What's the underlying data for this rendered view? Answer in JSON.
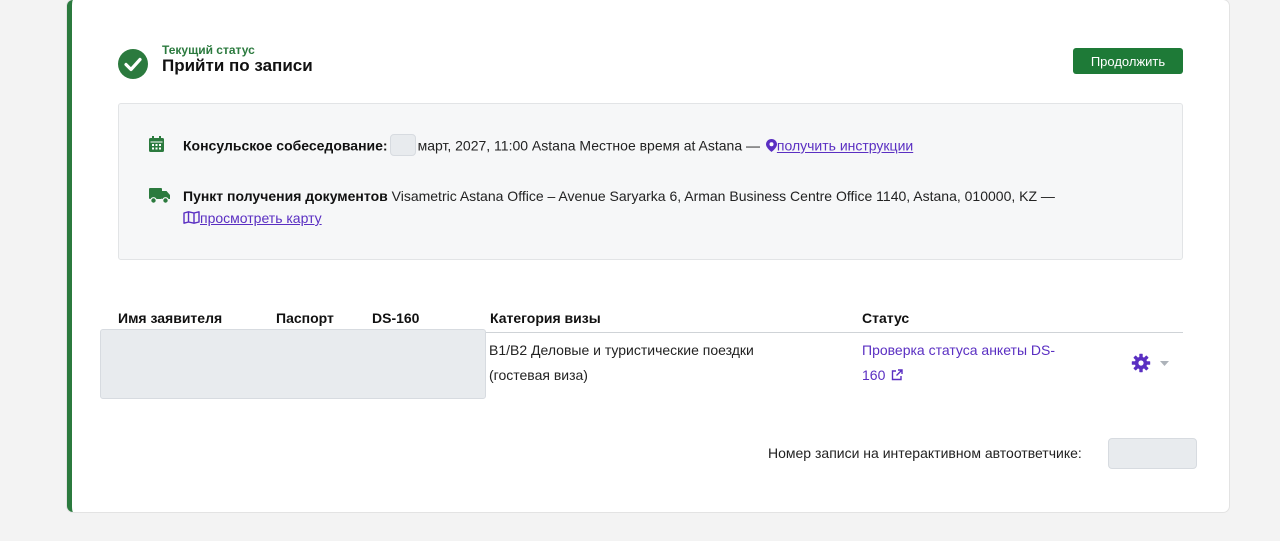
{
  "status": {
    "caption": "Текущий статус",
    "title": "Прийти по записи",
    "continue_label": "Продолжить"
  },
  "appointment": {
    "label": "Консульское собеседование:",
    "text": "март, 2027, 11:00 Astana Местное время at Astana —",
    "instructions_link": "получить инструкции",
    "pickup_label": "Пункт получения документов",
    "pickup_text": "Visametric Astana Office – Avenue Saryarka 6, Arman Business Centre Office 1140, Astana, 010000, KZ —",
    "map_link": "просмотреть карту"
  },
  "table": {
    "headers": {
      "name": "Имя заявителя",
      "passport": "Паспорт",
      "ds160": "DS-160",
      "category": "Категория визы",
      "status": "Статус"
    },
    "row": {
      "category_line1": "B1/B2 Деловые и туристические поездки",
      "category_line2": "(гостевая виза)",
      "status_line1": "Проверка статуса анкеты DS-",
      "status_line2": "160"
    }
  },
  "ivr": {
    "label": "Номер записи на интерактивном автоответчике:"
  },
  "colors": {
    "accent_green": "#2b7a3e",
    "link_purple": "#5a2fc2"
  }
}
